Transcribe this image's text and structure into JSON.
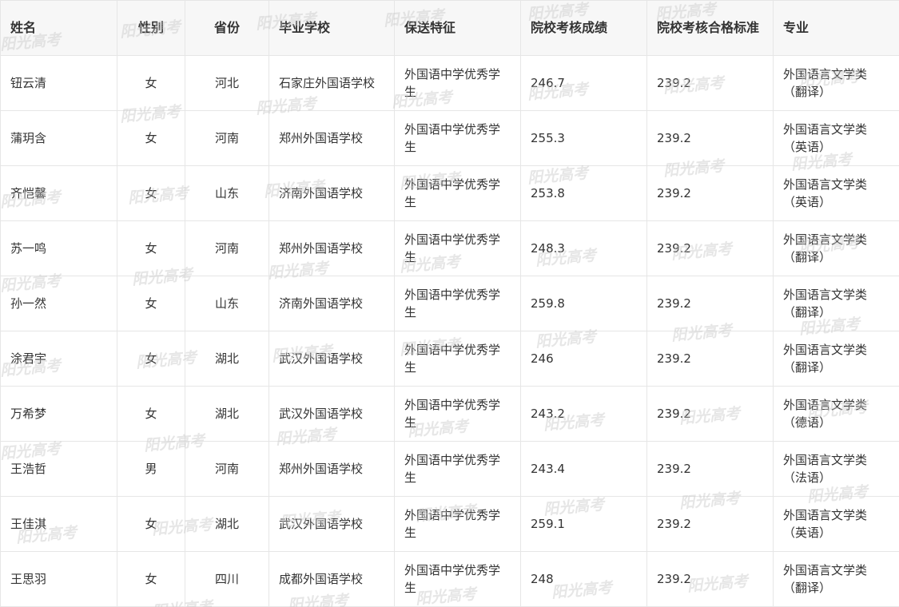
{
  "table": {
    "headers": [
      "姓名",
      "性别",
      "省份",
      "毕业学校",
      "保送特征",
      "院校考核成绩",
      "院校考核合格标准",
      "专业"
    ],
    "rows": [
      [
        "钮云清",
        "女",
        "河北",
        "石家庄外国语学校",
        "外国语中学优秀学生",
        "246.7",
        "239.2",
        "外国语言文学类（翻译）"
      ],
      [
        "蒲玥含",
        "女",
        "河南",
        "郑州外国语学校",
        "外国语中学优秀学生",
        "255.3",
        "239.2",
        "外国语言文学类（英语）"
      ],
      [
        "齐恺馨",
        "女",
        "山东",
        "济南外国语学校",
        "外国语中学优秀学生",
        "253.8",
        "239.2",
        "外国语言文学类（英语）"
      ],
      [
        "苏一鸣",
        "女",
        "河南",
        "郑州外国语学校",
        "外国语中学优秀学生",
        "248.3",
        "239.2",
        "外国语言文学类（翻译）"
      ],
      [
        "孙一然",
        "女",
        "山东",
        "济南外国语学校",
        "外国语中学优秀学生",
        "259.8",
        "239.2",
        "外国语言文学类（翻译）"
      ],
      [
        "涂君宇",
        "女",
        "湖北",
        "武汉外国语学校",
        "外国语中学优秀学生",
        "246",
        "239.2",
        "外国语言文学类（翻译）"
      ],
      [
        "万希梦",
        "女",
        "湖北",
        "武汉外国语学校",
        "外国语中学优秀学生",
        "243.2",
        "239.2",
        "外国语言文学类（德语）"
      ],
      [
        "王浩哲",
        "男",
        "河南",
        "郑州外国语学校",
        "外国语中学优秀学生",
        "243.4",
        "239.2",
        "外国语言文学类（法语）"
      ],
      [
        "王佳淇",
        "女",
        "湖北",
        "武汉外国语学校",
        "外国语中学优秀学生",
        "259.1",
        "239.2",
        "外国语言文学类（英语）"
      ],
      [
        "王思羽",
        "女",
        "四川",
        "成都外国语学校",
        "外国语中学优秀学生",
        "248",
        "239.2",
        "外国语言文学类（翻译）"
      ]
    ]
  },
  "watermark": {
    "text": "阳光高考"
  }
}
